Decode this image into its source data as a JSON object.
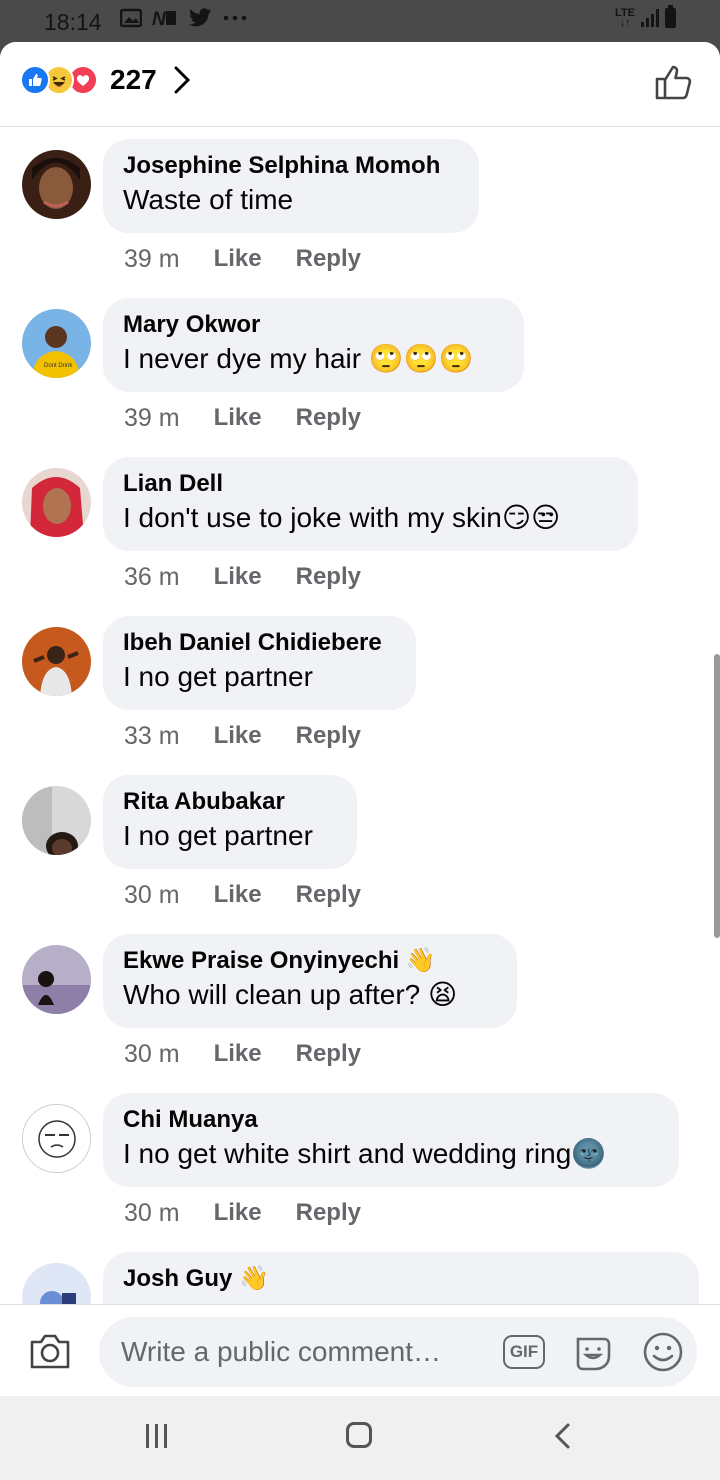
{
  "status_bar": {
    "time": "18:14",
    "network": "LTE"
  },
  "reactions": {
    "count": "227",
    "types": [
      "like-icon",
      "haha-icon",
      "love-icon"
    ]
  },
  "comments": [
    {
      "name": "Josephine Selphina Momoh",
      "text": "Waste of time",
      "time": "39 m",
      "like": "Like",
      "reply": "Reply",
      "avatar_color": "#3a1f14"
    },
    {
      "name": "Mary Okwor",
      "text": "I never dye my hair 🙄🙄🙄",
      "time": "39 m",
      "like": "Like",
      "reply": "Reply",
      "avatar_color": "#f2c200"
    },
    {
      "name": "Lian Dell",
      "text": "I don't use to joke with my skin😏😒",
      "time": "36 m",
      "like": "Like",
      "reply": "Reply",
      "avatar_color": "#d2283a"
    },
    {
      "name": "Ibeh Daniel Chidiebere",
      "text": "I no get partner",
      "time": "33 m",
      "like": "Like",
      "reply": "Reply",
      "avatar_color": "#c65a1e"
    },
    {
      "name": "Rita Abubakar",
      "text": "I no get partner",
      "time": "30 m",
      "like": "Like",
      "reply": "Reply",
      "avatar_color": "#cfcfcf"
    },
    {
      "name": "Ekwe Praise Onyinyechi 👋",
      "text": "Who will clean up after? 😫",
      "time": "30 m",
      "like": "Like",
      "reply": "Reply",
      "avatar_color": "#8e7fa8"
    },
    {
      "name": "Chi Muanya",
      "text": "I no get white shirt and wedding ring🌚",
      "time": "30 m",
      "like": "Like",
      "reply": "Reply",
      "avatar_color": "#ffffff"
    },
    {
      "name": "Josh Guy 👋",
      "text": "",
      "time": "",
      "like": "",
      "reply": "",
      "avatar_color": "#6a8fd6"
    }
  ],
  "composer": {
    "placeholder": "Write a public comment…",
    "gif_label": "GIF"
  },
  "colors": {
    "facebook_blue": "#1877f2",
    "bubble_bg": "#f0f2f5",
    "meta_gray": "#65676b"
  }
}
